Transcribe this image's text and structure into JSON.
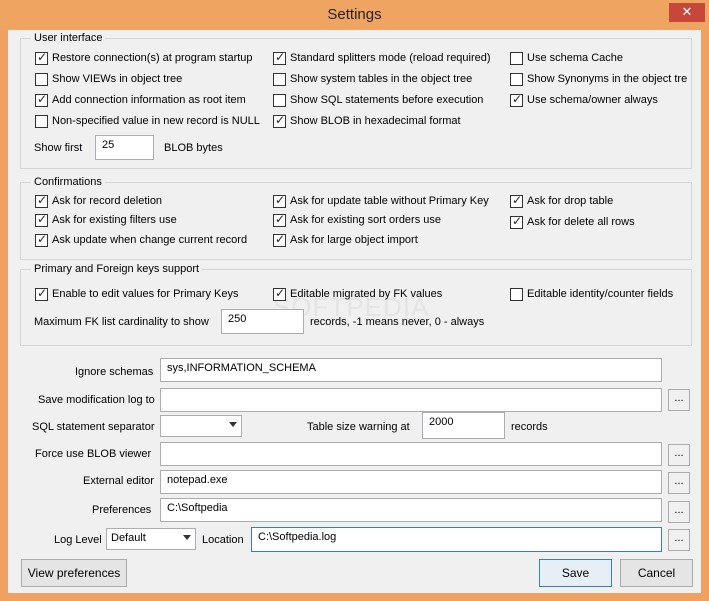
{
  "window": {
    "title": "Settings",
    "close_glyph": "✕"
  },
  "user_interface": {
    "label": "User interface",
    "checks": [
      {
        "label": "Restore connection(s) at program startup",
        "checked": true
      },
      {
        "label": "Standard splitters mode (reload required)",
        "checked": true
      },
      {
        "label": "Use schema Cache",
        "checked": false
      },
      {
        "label": "Show VIEWs in object tree",
        "checked": false
      },
      {
        "label": "Show system tables in the object tree",
        "checked": false
      },
      {
        "label": "Show Synonyms in the object tre",
        "checked": false
      },
      {
        "label": "Add connection information as root item",
        "checked": true
      },
      {
        "label": "Show SQL statements before execution",
        "checked": false
      },
      {
        "label": "Use schema/owner always",
        "checked": true
      },
      {
        "label": "Non-specified value in new record is NULL",
        "checked": false
      },
      {
        "label": "Show BLOB in hexadecimal format",
        "checked": true
      }
    ],
    "show_first_label": "Show first",
    "show_first_value": "25",
    "blob_bytes_label": "BLOB bytes"
  },
  "confirmations": {
    "label": "Confirmations",
    "checks": [
      {
        "label": "Ask for record deletion",
        "checked": true
      },
      {
        "label": "Ask for update table without Primary Key",
        "checked": true
      },
      {
        "label": "Ask for drop table",
        "checked": true
      },
      {
        "label": "Ask for existing filters use",
        "checked": true
      },
      {
        "label": "Ask for existing sort orders use",
        "checked": true
      },
      {
        "label": "Ask for delete all rows",
        "checked": true
      },
      {
        "label": "Ask update when change current record",
        "checked": true
      },
      {
        "label": "Ask for large object import",
        "checked": true
      }
    ]
  },
  "keys": {
    "label": "Primary and Foreign keys support",
    "checks": [
      {
        "label": "Enable to edit values for Primary Keys",
        "checked": true
      },
      {
        "label": "Editable migrated by FK values",
        "checked": true
      },
      {
        "label": "Editable identity/counter fields",
        "checked": false
      }
    ],
    "max_fk_label": "Maximum FK list cardinality to show",
    "max_fk_value": "250",
    "max_fk_suffix": "records, -1 means never, 0 - always"
  },
  "fields": {
    "ignore_schemas_label": "Ignore schemas",
    "ignore_schemas_value": "sys,INFORMATION_SCHEMA",
    "save_log_label": "Save modification log to",
    "save_log_value": "",
    "separator_label": "SQL statement separator",
    "separator_value": "",
    "table_size_label": "Table size warning at",
    "table_size_value": "2000",
    "table_size_suffix": "records",
    "blob_viewer_label": "Force use BLOB viewer",
    "blob_viewer_value": "",
    "external_editor_label": "External editor",
    "external_editor_value": "notepad.exe",
    "preferences_label": "Preferences",
    "preferences_value": "C:\\Softpedia",
    "log_level_label": "Log Level",
    "log_level_value": "Default",
    "location_label": "Location",
    "location_value": "C:\\Softpedia.log",
    "browse_glyph": "..."
  },
  "buttons": {
    "view_preferences": "View preferences",
    "save": "Save",
    "cancel": "Cancel"
  },
  "watermark": "SOFTPEDIA"
}
